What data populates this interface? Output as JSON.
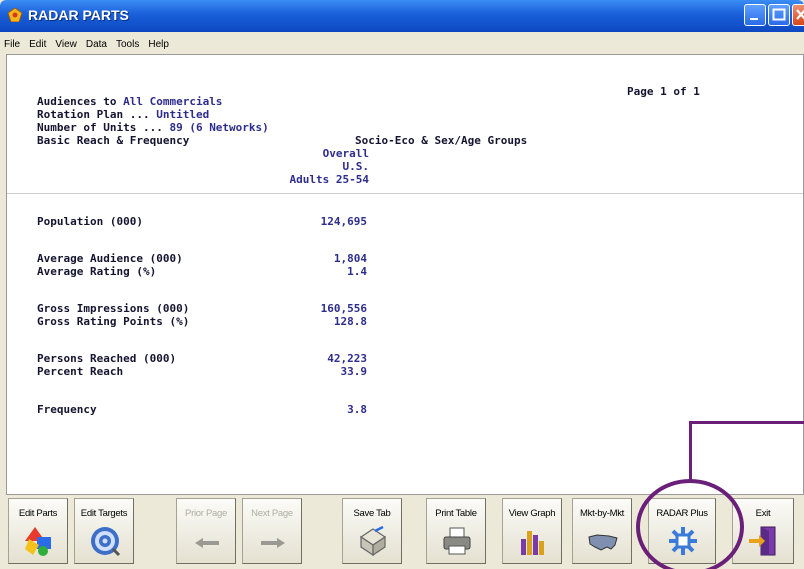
{
  "window": {
    "title": "RADAR PARTS"
  },
  "menu": [
    "File",
    "Edit",
    "View",
    "Data",
    "Tools",
    "Help"
  ],
  "report": {
    "page_indicator": "Page 1 of 1",
    "audience_line": "Audiences to All Commercials",
    "rotation_line": "Rotation Plan ... Untitled",
    "units_line": "Number of Units ... 89 (6 Networks)",
    "basic_line": "Basic Reach & Frequency",
    "groups_heading": "Socio-Eco & Sex/Age Groups",
    "column_head": [
      "Overall",
      "U.S.",
      "Adults 25-54"
    ],
    "rows": [
      {
        "label": "Population (000)",
        "value": "124,695"
      },
      {
        "label": "Average Audience (000)",
        "value": "1,804"
      },
      {
        "label": "Average Rating (%)",
        "value": "1.4"
      },
      {
        "label": "Gross Impressions (000)",
        "value": "160,556"
      },
      {
        "label": "Gross Rating Points (%)",
        "value": "128.8"
      },
      {
        "label": "Persons Reached (000)",
        "value": "42,223"
      },
      {
        "label": "Percent Reach",
        "value": "33.9"
      },
      {
        "label": "Frequency",
        "value": "3.8"
      }
    ]
  },
  "toolbar": {
    "buttons": [
      {
        "label": "Edit Parts",
        "icon": "shapes-icon",
        "enabled": true
      },
      {
        "label": "Edit Targets",
        "icon": "target-icon",
        "enabled": true
      },
      {
        "label": "Prior Page",
        "icon": "arrow-left-icon",
        "enabled": false
      },
      {
        "label": "Next Page",
        "icon": "arrow-right-icon",
        "enabled": false
      },
      {
        "label": "Save Tab",
        "icon": "save-icon",
        "enabled": true
      },
      {
        "label": "Print Table",
        "icon": "printer-icon",
        "enabled": true
      },
      {
        "label": "View Graph",
        "icon": "bar-graph-icon",
        "enabled": true
      },
      {
        "label": "Mkt-by-Mkt",
        "icon": "us-map-icon",
        "enabled": true
      },
      {
        "label": "RADAR Plus",
        "icon": "radar-plus-icon",
        "enabled": true
      },
      {
        "label": "Exit",
        "icon": "exit-door-icon",
        "enabled": true
      }
    ]
  },
  "colors": {
    "title_bar": "#1a5fd9",
    "report_values": "#2d2d8c",
    "callout": "#6a2079"
  }
}
